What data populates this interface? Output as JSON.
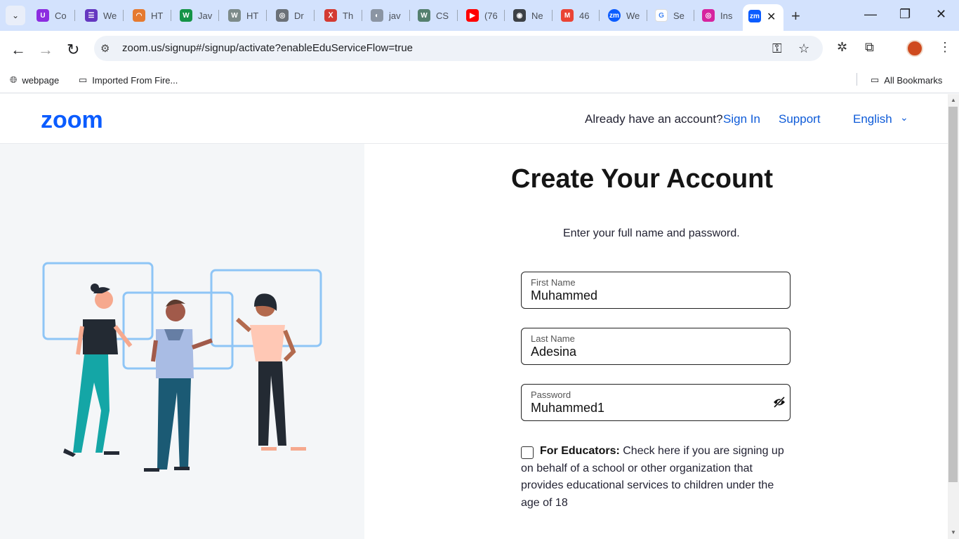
{
  "browser": {
    "tabs": [
      {
        "label": "Co",
        "favicon": "U"
      },
      {
        "label": "We",
        "favicon": "☰"
      },
      {
        "label": "HT",
        "favicon": "◠"
      },
      {
        "label": "Jav",
        "favicon": "W"
      },
      {
        "label": "HT",
        "favicon": "W"
      },
      {
        "label": "Dr",
        "favicon": "◎"
      },
      {
        "label": "Th",
        "favicon": "Ⅹ"
      },
      {
        "label": "jav",
        "favicon": "◐"
      },
      {
        "label": "CS",
        "favicon": "W"
      },
      {
        "label": "(76",
        "favicon": "▶"
      },
      {
        "label": "Ne",
        "favicon": "◉"
      },
      {
        "label": "46",
        "favicon": "M"
      },
      {
        "label": "We",
        "favicon": "zm"
      },
      {
        "label": "Se",
        "favicon": "G"
      },
      {
        "label": "Ins",
        "favicon": "◎"
      }
    ],
    "active_tab": {
      "favicon": "zm",
      "close": "✕"
    },
    "new_tab": "+",
    "window_controls": {
      "minimize": "—",
      "restore": "❐",
      "close": "✕"
    },
    "url": "zoom.us/signup#/signup/activate?enableEduServiceFlow=true",
    "bookmarks": [
      {
        "label": "webpage",
        "icon": "globe-icon"
      },
      {
        "label": "Imported From Fire...",
        "icon": "folder-icon"
      }
    ],
    "all_bookmarks": "All Bookmarks"
  },
  "header": {
    "logo": "zoom",
    "already_text": "Already have an account?",
    "signin": "Sign In",
    "support": "Support",
    "language": "English"
  },
  "form": {
    "title": "Create Your Account",
    "subtitle": "Enter your full name and password.",
    "first_name": {
      "label": "First Name",
      "value": "Muhammed"
    },
    "last_name": {
      "label": "Last Name",
      "value": "Adesina"
    },
    "password": {
      "label": "Password",
      "value": "Muhammed1"
    },
    "educator_bold": "For Educators:",
    "educator_text": "Check here if you are signing up on behalf of a school or other organization that provides educational services to children under the age of 18"
  },
  "colors": {
    "accent": "#0e5bd8",
    "logo": "#0b5cff"
  }
}
